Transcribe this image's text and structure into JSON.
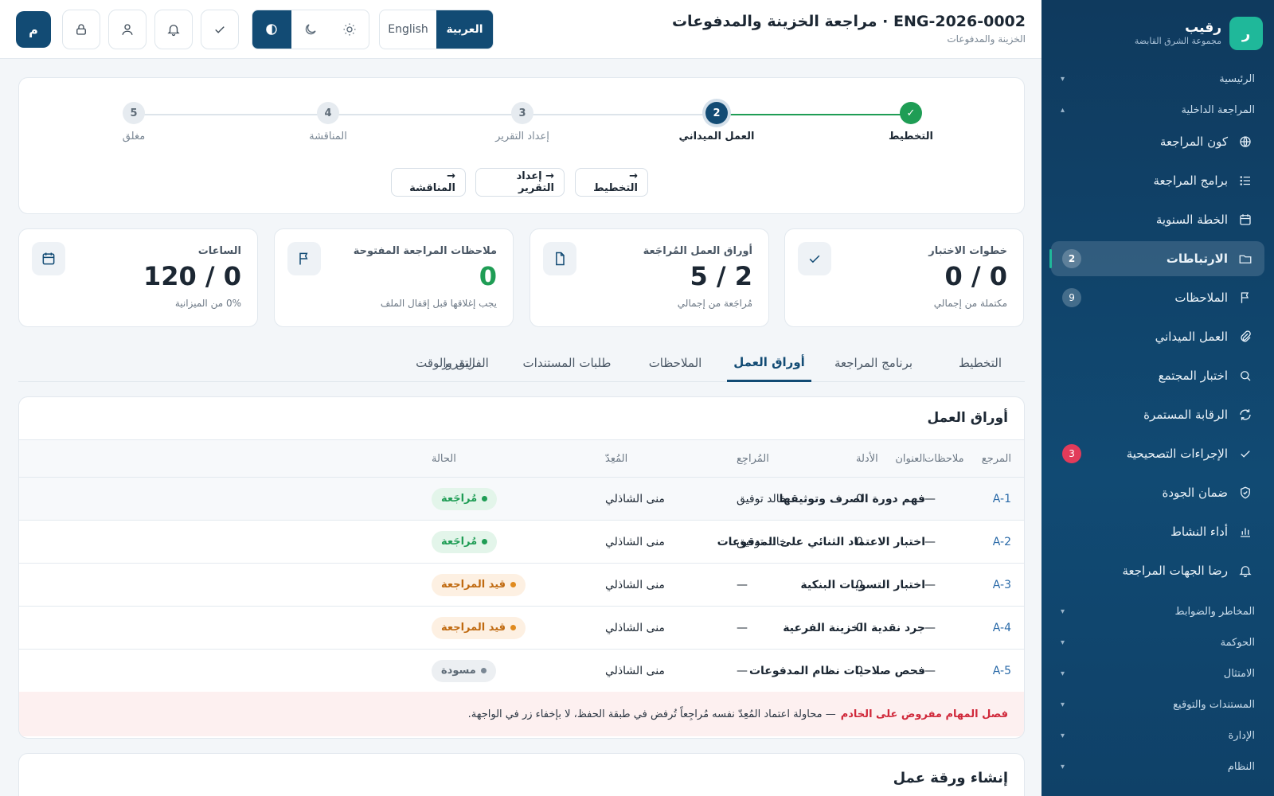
{
  "brand": {
    "logo": "ر",
    "name": "رقيب",
    "sub": "مجموعة الشرق القابضة"
  },
  "sidebar": {
    "sections": [
      {
        "label": "الرئيسية",
        "chev": "▾"
      },
      {
        "label": "المراجعة الداخلية",
        "chev": "▴"
      }
    ],
    "items": [
      {
        "label": "كون المراجعة",
        "icon": "globe-icon",
        "badge": ""
      },
      {
        "label": "برامج المراجعة",
        "icon": "list-icon",
        "badge": ""
      },
      {
        "label": "الخطة السنوية",
        "icon": "calendar-icon",
        "badge": ""
      },
      {
        "label": "الارتباطات",
        "icon": "folder-icon",
        "badge": "2",
        "active": true
      },
      {
        "label": "الملاحظات",
        "icon": "flag-icon",
        "badge": "9"
      },
      {
        "label": "العمل الميداني",
        "icon": "paperclip-icon",
        "badge": ""
      },
      {
        "label": "اختبار المجتمع",
        "icon": "search-icon",
        "badge": ""
      },
      {
        "label": "الرقابة المستمرة",
        "icon": "refresh-icon",
        "badge": ""
      },
      {
        "label": "الإجراءات التصحيحية",
        "icon": "check-icon",
        "badge": "3",
        "badge_color": "#e23b5a"
      },
      {
        "label": "ضمان الجودة",
        "icon": "shield-icon",
        "badge": ""
      },
      {
        "label": "أداء النشاط",
        "icon": "bar-chart-icon",
        "badge": ""
      },
      {
        "label": "رضا الجهات المراجعة",
        "icon": "bell-icon",
        "badge": ""
      }
    ],
    "lower_sections": [
      {
        "label": "المخاطر والضوابط",
        "chev": "▾"
      },
      {
        "label": "الحوكمة",
        "chev": "▾"
      },
      {
        "label": "الامتثال",
        "chev": "▾"
      },
      {
        "label": "المستندات والتوقيع",
        "chev": "▾"
      },
      {
        "label": "الإدارة",
        "chev": "▾"
      },
      {
        "label": "النظام",
        "chev": "▾"
      }
    ]
  },
  "header": {
    "title": "ENG-2026-0002 · مراجعة الخزينة والمدفوعات",
    "breadcrumb": "الخزينة والمدفوعات",
    "lang_ar": "العربية",
    "lang_en": "English",
    "user_initial": "م"
  },
  "stepper": {
    "steps": [
      {
        "num": "✓",
        "label": "التخطيط",
        "state": "done"
      },
      {
        "num": "2",
        "label": "العمل الميداني",
        "state": "current"
      },
      {
        "num": "3",
        "label": "إعداد التقرير",
        "state": "todo"
      },
      {
        "num": "4",
        "label": "المناقشة",
        "state": "todo"
      },
      {
        "num": "5",
        "label": "مغلق",
        "state": "todo"
      }
    ],
    "move_buttons": [
      "→ التخطيط",
      "→ إعداد التقرير",
      "→ المناقشة"
    ]
  },
  "stats": [
    {
      "title": "خطوات الاختبار",
      "value": "0 / 0",
      "footer": "مكتملة من إجمالي",
      "icon": "check-icon"
    },
    {
      "title": "أوراق العمل المُراجَعة",
      "value": "5 / 2",
      "footer": "مُراجَعة من إجمالي",
      "icon": "document-icon"
    },
    {
      "title": "ملاحظات المراجعة المفتوحة",
      "value": "0",
      "footer": "يجب إغلاقها قبل إقفال الملف",
      "icon": "flag-icon",
      "color": "#1f9d55"
    },
    {
      "title": "الساعات",
      "value": "120 / 0",
      "footer": "0% من الميزانية",
      "icon": "calendar-icon"
    }
  ],
  "tabs": [
    "التخطيط",
    "برنامج المراجعة",
    "أوراق العمل",
    "الملاحظات",
    "طلبات المستندات",
    "الفريق والوقت",
    "التقرير"
  ],
  "active_tab": "أوراق العمل",
  "workpapers": {
    "title": "أوراق العمل",
    "columns": {
      "ref": "المرجع",
      "title": "العنوان",
      "status": "الحالة",
      "preparer": "المُعِدّ",
      "reviewer": "المُراجِع",
      "evidence": "الأدلة",
      "notes": "ملاحظات"
    },
    "rows": [
      {
        "ref": "A-1",
        "title": "فهم دورة الصرف وتوثيقها",
        "status": "مُراجَعة",
        "status_kind": "g",
        "preparer": "منى الشاذلي",
        "reviewer": "خالد توفيق",
        "evidence": "0",
        "notes": "—"
      },
      {
        "ref": "A-2",
        "title": "اختبار الاعتماد الثنائي على المدفوعات",
        "status": "مُراجَعة",
        "status_kind": "g",
        "preparer": "منى الشاذلي",
        "reviewer": "خالد توفيق",
        "evidence": "0",
        "notes": "—"
      },
      {
        "ref": "A-3",
        "title": "اختبار التسويات البنكية",
        "status": "قيد المراجعة",
        "status_kind": "o",
        "preparer": "منى الشاذلي",
        "reviewer": "—",
        "evidence": "0",
        "notes": "—"
      },
      {
        "ref": "A-4",
        "title": "جرد نقدية الخزينة الفرعية",
        "status": "قيد المراجعة",
        "status_kind": "o",
        "preparer": "منى الشاذلي",
        "reviewer": "—",
        "evidence": "0",
        "notes": "—"
      },
      {
        "ref": "A-5",
        "title": "فحص صلاحيات نظام المدفوعات",
        "status": "مسودة",
        "status_kind": "gr",
        "preparer": "منى الشاذلي",
        "reviewer": "—",
        "evidence": "0",
        "notes": "—"
      }
    ],
    "warning_strong": "فصل المهام مفروض على الخادم",
    "warning_text": "— محاولة اعتماد المُعِدّ نفسه مُراجِعاً تُرفض في طبقة الحفظ، لا بإخفاء زر في الواجهة."
  },
  "create": {
    "title": "إنشاء ورقة عمل"
  }
}
